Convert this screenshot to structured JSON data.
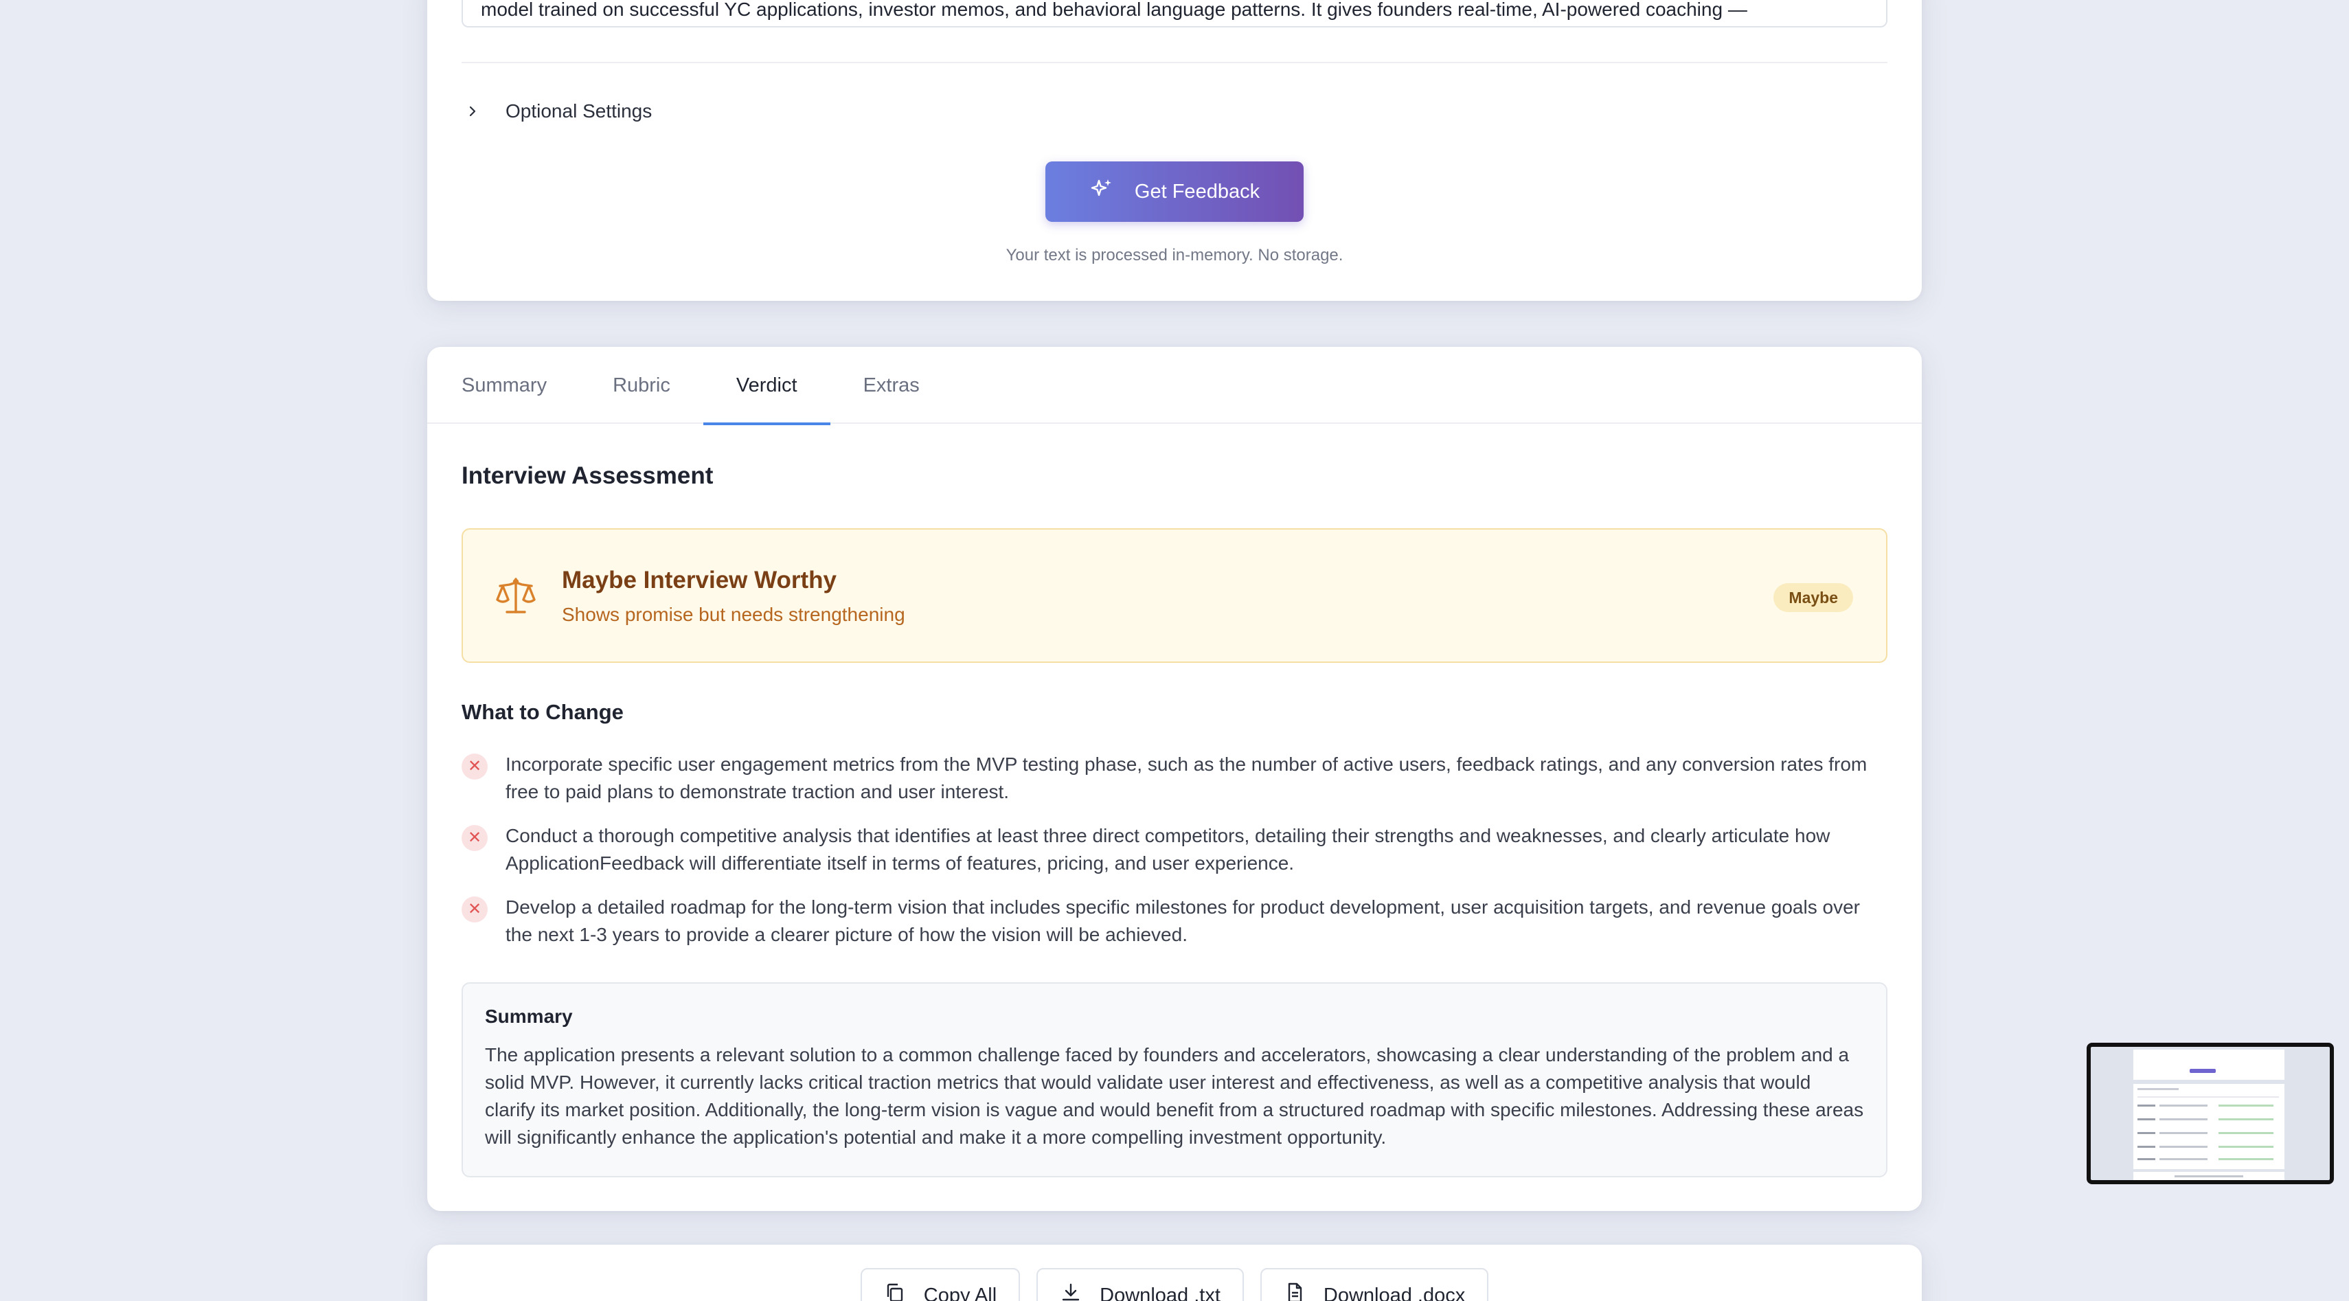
{
  "input": {
    "text_tail": "model trained on successful YC applications, investor memos, and behavioral language patterns. It gives founders real-time, AI-powered coaching —"
  },
  "optional_settings": {
    "label": "Optional Settings",
    "icon": "chevron-right-icon"
  },
  "submit": {
    "label": "Get Feedback",
    "icon": "sparkles-icon",
    "gradient": [
      "#6b7fe0",
      "#7350b3"
    ]
  },
  "privacy_note": "Your text is processed in-memory. No storage.",
  "tabs": [
    {
      "label": "Summary",
      "active": false
    },
    {
      "label": "Rubric",
      "active": false
    },
    {
      "label": "Verdict",
      "active": true
    },
    {
      "label": "Extras",
      "active": false
    }
  ],
  "verdict": {
    "section_title": "Interview Assessment",
    "icon": "balance-scale-icon",
    "title": "Maybe Interview Worthy",
    "subtitle": "Shows promise but needs strengthening",
    "badge": "Maybe",
    "accent": "#d9822b"
  },
  "changes": {
    "title": "What to Change",
    "items": [
      "Incorporate specific user engagement metrics from the MVP testing phase, such as the number of active users, feedback ratings, and any conversion rates from free to paid plans to demonstrate traction and user interest.",
      "Conduct a thorough competitive analysis that identifies at least three direct competitors, detailing their strengths and weaknesses, and clearly articulate how ApplicationFeedback will differentiate itself in terms of features, pricing, and user experience.",
      "Develop a detailed roadmap for the long-term vision that includes specific milestones for product development, user acquisition targets, and revenue goals over the next 1-3 years to provide a clearer picture of how the vision will be achieved."
    ]
  },
  "summary": {
    "title": "Summary",
    "text": "The application presents a relevant solution to a common challenge faced by founders and accelerators, showcasing a clear understanding of the problem and a solid MVP. However, it currently lacks critical traction metrics that would validate user interest and effectiveness, as well as a competitive analysis that would clarify its market position. Additionally, the long-term vision is vague and would benefit from a structured roadmap with specific milestones. Addressing these areas will significantly enhance the application's potential and make it a more compelling investment opportunity."
  },
  "actions": [
    {
      "label": "Copy All",
      "icon": "copy-icon"
    },
    {
      "label": "Download .txt",
      "icon": "download-icon"
    },
    {
      "label": "Download .docx",
      "icon": "document-icon"
    }
  ]
}
